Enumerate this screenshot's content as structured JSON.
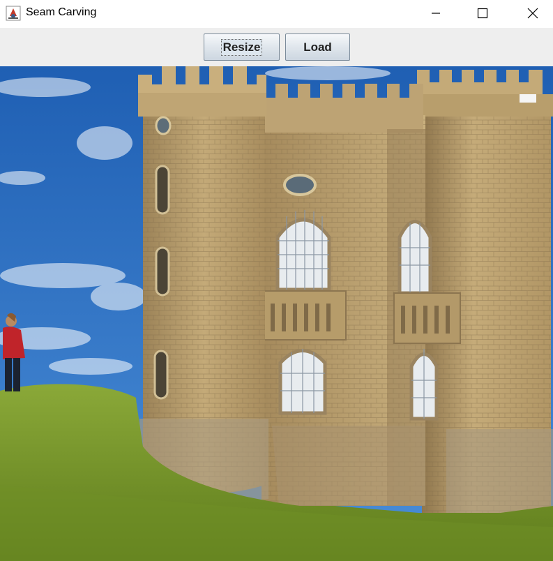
{
  "window": {
    "title": "Seam Carving",
    "controls": [
      "minimize",
      "maximize",
      "close"
    ]
  },
  "toolbar": {
    "resize_label": "Resize",
    "load_label": "Load"
  },
  "image": {
    "subject": "photo-castle-with-person-on-hill",
    "colors": {
      "sky": "#2d73c4",
      "stone": "#b59b6a",
      "grass": "#7a9a2c",
      "jacket": "#c0242a"
    }
  }
}
